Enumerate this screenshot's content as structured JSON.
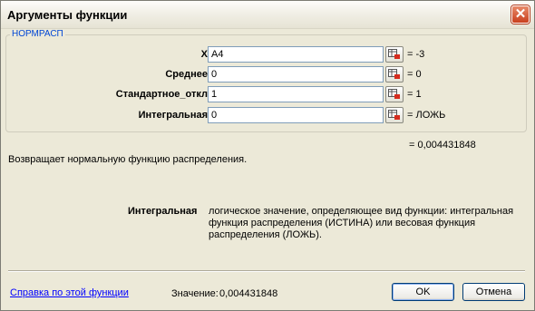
{
  "dialog": {
    "title": "Аргументы функции",
    "close_icon": "close-icon"
  },
  "function": {
    "name": "НОРМРАСП",
    "result": "= 0,004431848",
    "description": "Возвращает нормальную функцию распределения."
  },
  "arguments": [
    {
      "label": "X",
      "value": "A4",
      "result": "= -3",
      "icon": "range-select-icon"
    },
    {
      "label": "Среднее",
      "value": "0",
      "result": "= 0",
      "icon": "range-select-icon"
    },
    {
      "label": "Стандартное_откл",
      "value": "1",
      "result": "= 1",
      "icon": "range-select-icon"
    },
    {
      "label": "Интегральная",
      "value": "0",
      "result": "= ЛОЖЬ",
      "icon": "range-select-icon"
    }
  ],
  "help": {
    "arg_name": "Интегральная",
    "text": "логическое значение, определяющее вид функции: интегральная функция распределения (ИСТИНА) или весовая функция распределения (ЛОЖЬ)."
  },
  "footer": {
    "help_link": "Справка по этой функции",
    "value_label": "Значение:",
    "value": "0,004431848",
    "ok_label": "OK",
    "cancel_label": "Отмена"
  }
}
